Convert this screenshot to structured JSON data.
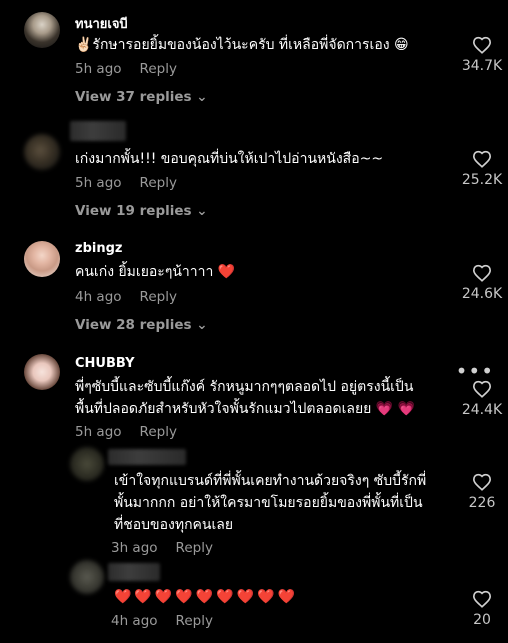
{
  "comments": [
    {
      "username": "ทนายเจบี",
      "text": "✌🏻รักษารอยยิ้มของน้องไว้นะครับ ที่เหลือพี่จัดการเอง",
      "emoji": "😁",
      "time": "5h ago",
      "reply_label": "Reply",
      "likes": "34.7K",
      "view_replies": "View 37 replies"
    },
    {
      "username": "",
      "text": "เก่งมากพั้น!!! ขอบคุณที่บ่นให้เปาไปอ่านหนังสือ~~",
      "time": "5h ago",
      "reply_label": "Reply",
      "likes": "25.2K",
      "view_replies": "View 19 replies"
    },
    {
      "username": "zbingz",
      "text": "คนเก่ง ยิ้มเยอะๆน้าาาา",
      "emoji": "❤️",
      "time": "4h ago",
      "reply_label": "Reply",
      "likes": "24.6K",
      "view_replies": "View 28 replies"
    },
    {
      "username": "CHUBBY",
      "text_line1": "พี่ๆซับบี้และซับบี้แก๊งค์ รักหนูมากๆๆตลอดไป อยู่ตรงนี้เป็น",
      "text_line2": "พื้นที่ปลอดภัยสำหรับหัวใจพั้นรักแมวไปตลอดเลยย",
      "emoji": "💗 💗",
      "time": "5h ago",
      "reply_label": "Reply",
      "likes": "24.4K",
      "more_icon": "•••"
    }
  ],
  "replies": [
    {
      "username": "",
      "text_line1": "เข้าใจทุกแบรนด์ที่พี่พั้นเคยทำงานด้วยจริงๆ ซับบี้รักพี่",
      "text_line2": "พั้นมากกก อย่าให้ใครมาขโมยรอยยิ้มของพี่พั้นที่เป็น",
      "text_line3": "ที่ชอบของทุกคนเลย",
      "time": "3h ago",
      "reply_label": "Reply",
      "likes": "226"
    },
    {
      "username": "",
      "text": "❤️❤️❤️❤️❤️❤️❤️❤️❤️",
      "time": "4h ago",
      "reply_label": "Reply",
      "likes": "20"
    }
  ],
  "colors": {
    "background": "#000000",
    "meta_text": "#9a9a9a",
    "heart_outline": "#d0d0d0",
    "red_heart": "#e5243b"
  }
}
